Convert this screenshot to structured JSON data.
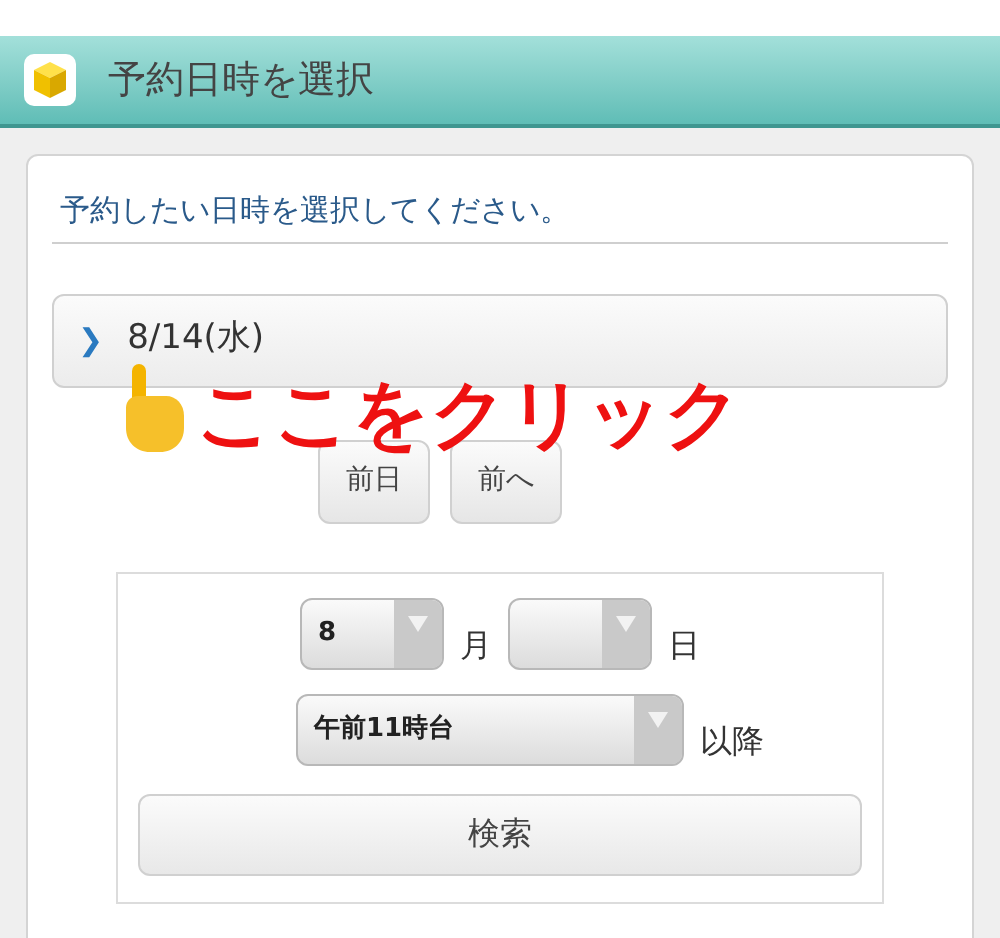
{
  "header": {
    "title": "予約日時を選択"
  },
  "instruction": "予約したい日時を選択してください。",
  "date_row": {
    "caret": "❯",
    "label": "8/14(水)",
    "expanded": false
  },
  "annotation": {
    "text": "ここをクリック"
  },
  "nav_buttons": [
    "前日",
    "前へ"
  ],
  "search_form": {
    "month": {
      "value": "8",
      "unit": "月"
    },
    "day": {
      "unit": "日"
    },
    "time": {
      "value": "午前11時台",
      "suffix": "以降"
    },
    "button": "検索"
  }
}
